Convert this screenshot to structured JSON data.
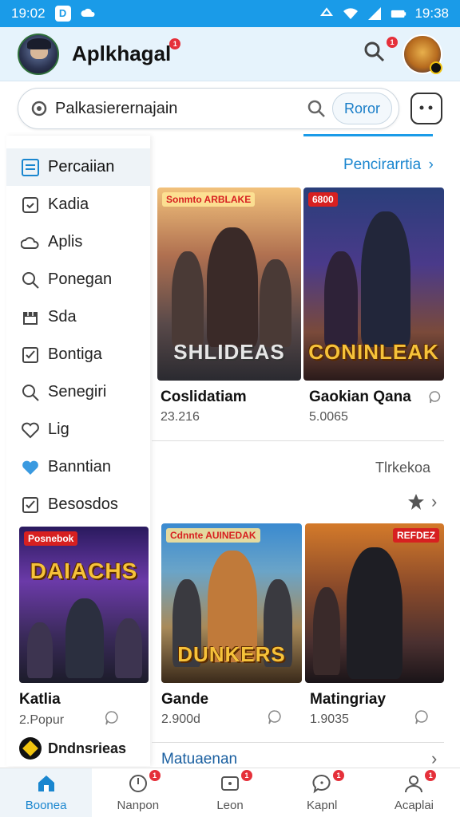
{
  "status_bar": {
    "time_left": "19:02",
    "time_right": "19:38"
  },
  "app": {
    "title": "Aplkhagal",
    "title_badge": "1",
    "search_badge": "1"
  },
  "search": {
    "text": "Palkasierernajain",
    "button_label": "Roror"
  },
  "sidebar": {
    "items": [
      {
        "label": "Percaiian",
        "icon": "list-icon",
        "active": true
      },
      {
        "label": "Kadia",
        "icon": "checkbox-icon"
      },
      {
        "label": "Aplis",
        "icon": "cloud-icon"
      },
      {
        "label": "Ponegan",
        "icon": "search-icon"
      },
      {
        "label": "Sda",
        "icon": "store-icon"
      },
      {
        "label": "Bontiga",
        "icon": "checked-box-icon"
      },
      {
        "label": "Senegiri",
        "icon": "search-icon"
      },
      {
        "label": "Lig",
        "icon": "heart-outline-icon"
      },
      {
        "label": "Banntian",
        "icon": "heart-filled-icon"
      },
      {
        "label": "Besosdos",
        "icon": "checked-box-icon"
      }
    ],
    "promo": {
      "tag": "Posnebok",
      "art_title": "DAIACHS",
      "title": "Katlia",
      "meta": "2.Popur",
      "footer": "Dndnsrieas"
    }
  },
  "section1": {
    "link": "Pencirarrtia"
  },
  "cards_row1": [
    {
      "tag": "Sonmto ARBLAKE",
      "art_title": "SHLIDEAS",
      "title": "Coslidatiam",
      "meta": "23.216"
    },
    {
      "tag": "6800",
      "art_title": "CONINLEAK",
      "title": "Gaokian Qana",
      "meta": "5.0065"
    }
  ],
  "section2": {
    "label": "Tlrkekoa"
  },
  "cards_row2": [
    {
      "tag": "Cdnnte AUINEDAK",
      "art_title": "DUNKERS",
      "title": "Gande",
      "meta": "2.900d"
    },
    {
      "tag": "REFDEZ",
      "art_title": "",
      "title": "Matingriay",
      "meta": "1.9035"
    }
  ],
  "section3": {
    "link": "Matuaenan"
  },
  "bottom_nav": [
    {
      "label": "Boonea",
      "icon": "home-icon",
      "active": true
    },
    {
      "label": "Nanpon",
      "icon": "compass-icon",
      "badge": "1"
    },
    {
      "label": "Leon",
      "icon": "apps-icon",
      "badge": "1"
    },
    {
      "label": "Kapnl",
      "icon": "chat-icon",
      "badge": "1"
    },
    {
      "label": "Acaplai",
      "icon": "profile-icon",
      "badge": "1"
    }
  ]
}
